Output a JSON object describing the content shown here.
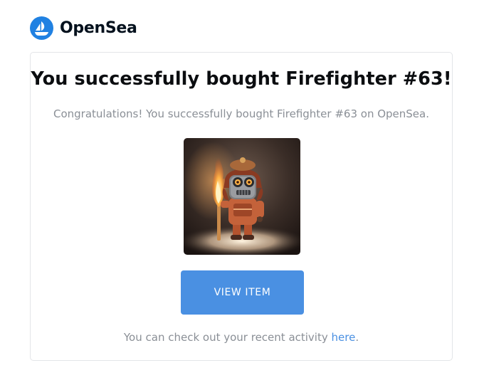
{
  "brand": {
    "name": "OpenSea",
    "logo_icon": "opensea-boat-icon",
    "color": "#2081e2"
  },
  "email": {
    "title": "You successfully bought Firefighter #63!",
    "message": "Congratulations! You successfully bought Firefighter #63 on OpenSea.",
    "item_image": {
      "icon": "firefighter-robot-nft-image",
      "alt": "Firefighter #63"
    },
    "button_label": "VIEW ITEM",
    "button_color": "#4a90e2",
    "footer_prefix": "You can check out your recent activity ",
    "footer_link": "here",
    "footer_suffix": "."
  }
}
